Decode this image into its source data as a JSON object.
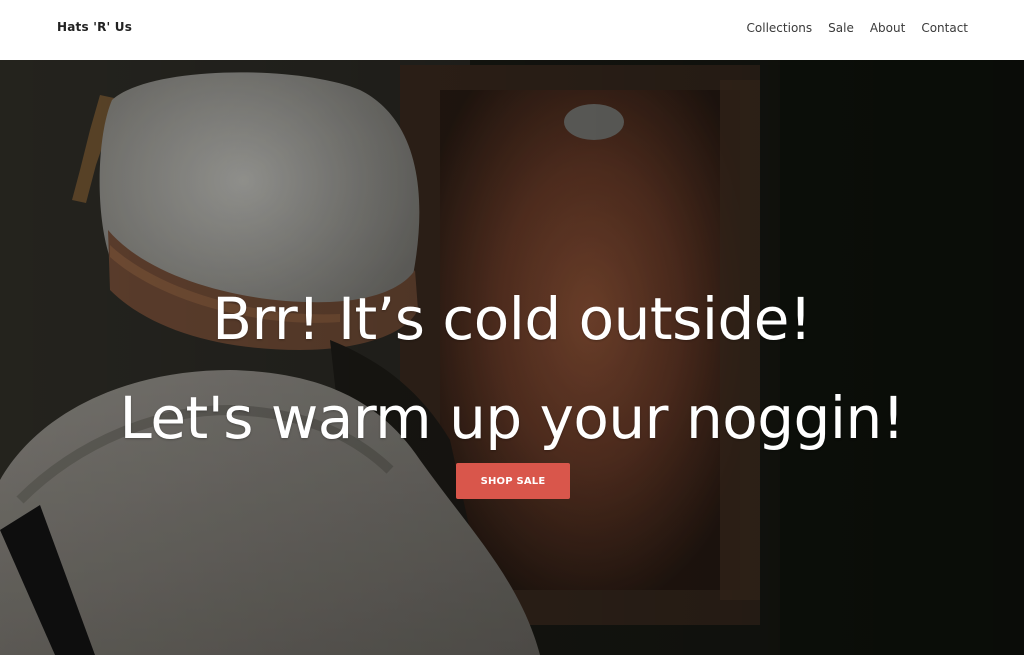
{
  "header": {
    "brand": "Hats 'R' Us",
    "nav": [
      "Collections",
      "Sale",
      "About",
      "Contact"
    ]
  },
  "hero": {
    "headline_line1": "Brr! It’s cold outside!",
    "headline_line2": "Let's warm up your noggin!",
    "cta_label": "SHOP SALE",
    "image": "photo-person-in-knit-hat-by-window"
  },
  "colors": {
    "header_bg": "#ffffff",
    "brand_text": "#222222",
    "nav_text": "#3a3a3a",
    "hero_text": "#ffffff",
    "cta_bg": "#d9564b"
  }
}
